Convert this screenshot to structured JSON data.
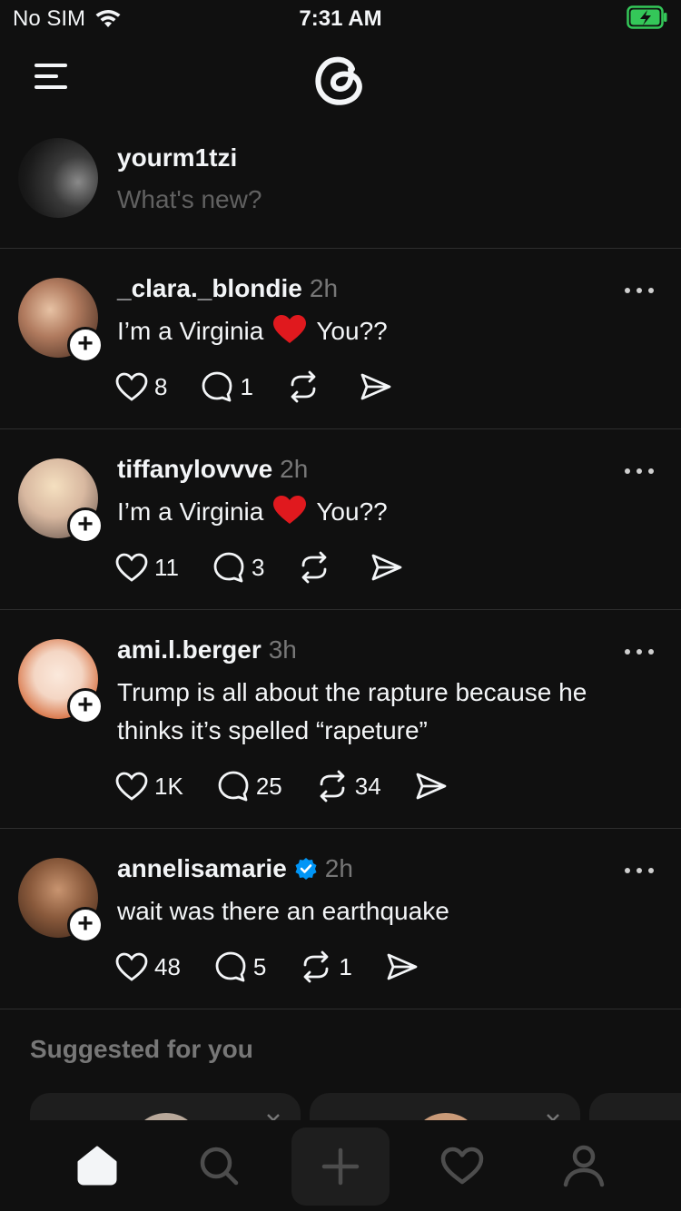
{
  "status": {
    "carrier": "No SIM",
    "time": "7:31 AM"
  },
  "composer": {
    "username": "yourm1tzi",
    "placeholder": "What's new?"
  },
  "posts": [
    {
      "username": "_clara._blondie",
      "time": "2h",
      "verified": false,
      "text_before": "I’m a Virginia",
      "text_after": "You??",
      "has_heart_emoji": true,
      "likes": "8",
      "replies": "1",
      "reposts": "",
      "avatar_color": "#b07a5e"
    },
    {
      "username": "tiffanylovvve",
      "time": "2h",
      "verified": false,
      "text_before": "I’m a Virginia",
      "text_after": "You??",
      "has_heart_emoji": true,
      "likes": "11",
      "replies": "3",
      "reposts": "",
      "avatar_color": "#d8b8a0"
    },
    {
      "username": "ami.l.berger",
      "time": "3h",
      "verified": false,
      "text": "Trump is all about the rapture because he thinks it’s spelled “rapeture”",
      "likes": "1K",
      "replies": "25",
      "reposts": "34",
      "avatar_color": "#f4d6c4"
    },
    {
      "username": "annelisamarie",
      "time": "2h",
      "verified": true,
      "text": "wait was there an earthquake",
      "likes": "48",
      "replies": "5",
      "reposts": "1",
      "avatar_color": "#8a5a3c"
    }
  ],
  "suggested": {
    "title": "Suggested for you"
  },
  "colors": {
    "background": "#101010",
    "text": "#f3f5f7",
    "muted": "#777777",
    "verified": "#0095f6",
    "heart": "#e0191e"
  },
  "icons": [
    "menu-icon",
    "threads-logo",
    "heart-icon",
    "comment-icon",
    "repost-icon",
    "share-icon",
    "more-icon",
    "home-icon",
    "search-icon",
    "create-icon",
    "activity-icon",
    "profile-icon"
  ]
}
